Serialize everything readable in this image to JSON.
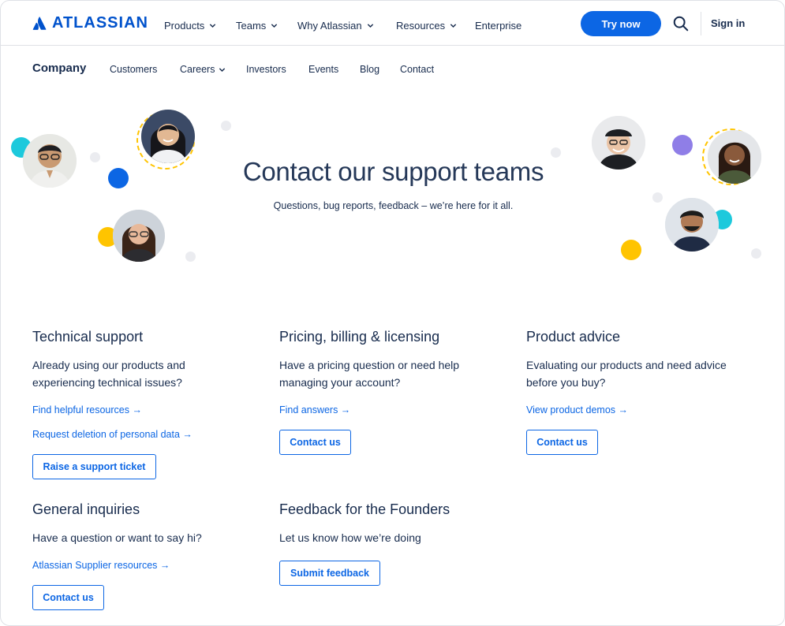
{
  "brand": {
    "name": "ATLASSIAN",
    "color": "#0052cc"
  },
  "topnav": {
    "items": [
      {
        "label": "Products",
        "dropdown": true
      },
      {
        "label": "Teams",
        "dropdown": true
      },
      {
        "label": "Why Atlassian",
        "dropdown": true
      },
      {
        "label": "Resources",
        "dropdown": true
      },
      {
        "label": "Enterprise",
        "dropdown": false
      }
    ],
    "cta": "Try now",
    "search_icon": "search-icon",
    "signin": "Sign in"
  },
  "subnav": {
    "title": "Company",
    "items": [
      {
        "label": "Customers",
        "dropdown": false
      },
      {
        "label": "Careers",
        "dropdown": true
      },
      {
        "label": "Investors",
        "dropdown": false
      },
      {
        "label": "Events",
        "dropdown": false
      },
      {
        "label": "Blog",
        "dropdown": false
      },
      {
        "label": "Contact",
        "dropdown": false
      }
    ]
  },
  "hero": {
    "title": "Contact our support teams",
    "subtitle": "Questions, bug reports, feedback – we’re here for it all."
  },
  "sections": {
    "technical": {
      "title": "Technical support",
      "description": "Already using our products and experiencing technical issues?",
      "links": [
        "Find helpful resources →",
        "Request deletion of personal data →"
      ],
      "button": "Raise a support ticket"
    },
    "billing": {
      "title": "Pricing, billing & licensing",
      "description": "Have a pricing question or need help managing your account?",
      "links": [
        "Find answers →"
      ],
      "button": "Contact us"
    },
    "advice": {
      "title": "Product advice",
      "description": "Evaluating our products and need advice before you buy?",
      "links": [
        "View product demos →"
      ],
      "button": "Contact us"
    },
    "general": {
      "title": "General inquiries",
      "description": "Have a question or want to say hi?",
      "links": [
        "Atlassian Supplier resources →"
      ],
      "button": "Contact us"
    },
    "founders": {
      "title": "Feedback for the Founders",
      "description": "Let us know how we’re doing",
      "button": "Submit feedback"
    }
  },
  "colors": {
    "primary": "#0c66e4",
    "text": "#172b4d",
    "accent_cyan": "#1dc9dc",
    "accent_blue": "#0c66e4",
    "accent_yellow": "#ffc400",
    "accent_purple": "#8f7ee7",
    "dot_gray": "#ebecf0"
  }
}
